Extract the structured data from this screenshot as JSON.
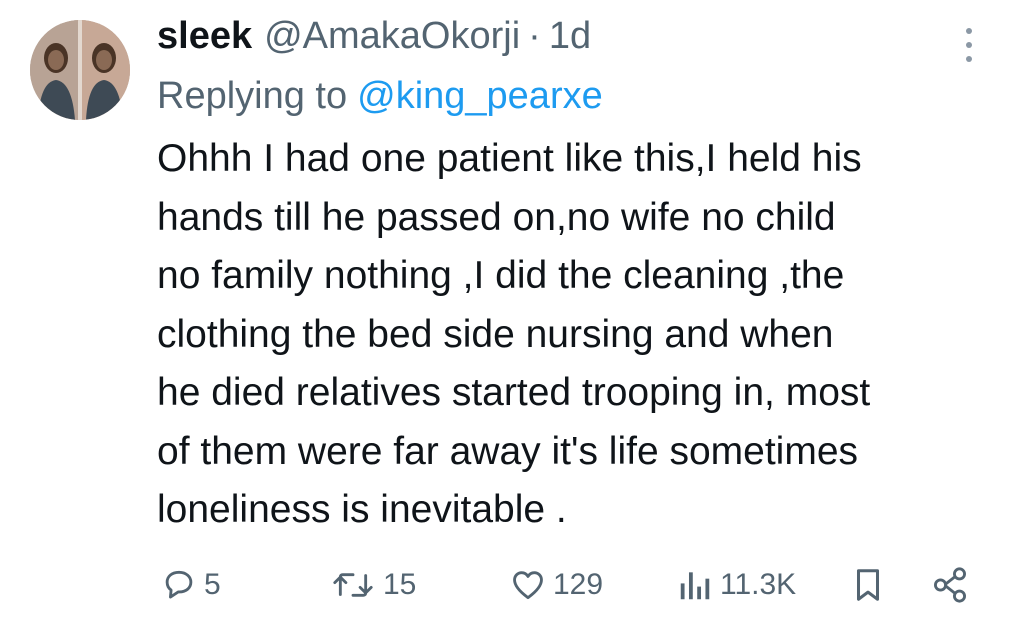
{
  "tweet": {
    "author": {
      "display_name": "sleek",
      "handle": "@AmakaOkorji",
      "separator": "·",
      "time_ago": "1d"
    },
    "reply": {
      "prefix": "Replying to",
      "mention": "@king_pearxe"
    },
    "text_lines": [
      "Ohhh I had one patient like this,I held his",
      "hands till he passed on,no wife no child",
      "no family nothing ,I did the cleaning ,the",
      "clothing the bed side nursing and when",
      "he died relatives started trooping in, most",
      "of them were far away it's life sometimes",
      "loneliness is inevitable ."
    ],
    "actions": {
      "replies": {
        "icon": "reply-icon",
        "count": "5"
      },
      "reposts": {
        "icon": "repost-icon",
        "count": "15"
      },
      "likes": {
        "icon": "heart-icon",
        "count": "129"
      },
      "views": {
        "icon": "analytics-icon",
        "count": "11.3K"
      },
      "bookmark": {
        "icon": "bookmark-icon"
      },
      "share": {
        "icon": "share-icon"
      }
    },
    "colors": {
      "text": "#0f1419",
      "secondary": "#536471",
      "link": "#1d9bf0"
    }
  }
}
